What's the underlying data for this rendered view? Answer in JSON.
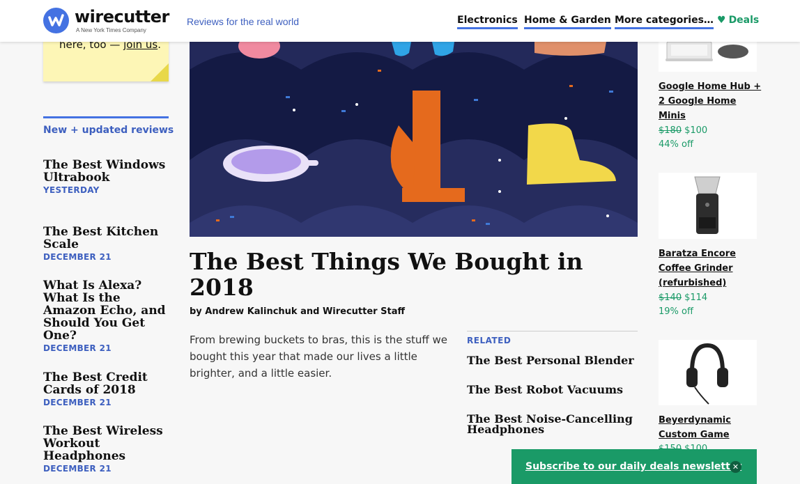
{
  "header": {
    "logo_text": "wirecutter",
    "logo_sub": "A New York Times Company",
    "tagline": "Reviews for the real world",
    "nav": [
      "Electronics",
      "Home & Garden",
      "More categories…"
    ],
    "deals_label": "Deals"
  },
  "sticky": {
    "text_before": "here, too — ",
    "link": "join us",
    "text_after": "."
  },
  "sidebar": {
    "heading": "New + updated reviews",
    "items": [
      {
        "title": "The Best Windows Ultrabook",
        "date": "YESTERDAY"
      },
      {
        "title": "The Best Kitchen Scale",
        "date": "DECEMBER 21"
      },
      {
        "title": "What Is Alexa? What Is the Amazon Echo, and Should You Get One?",
        "date": "DECEMBER 21"
      },
      {
        "title": "The Best Credit Cards of 2018",
        "date": "DECEMBER 21"
      },
      {
        "title": "The Best Wireless Workout Headphones",
        "date": "DECEMBER 21"
      }
    ]
  },
  "article": {
    "title": "The Best Things We Bought in 2018",
    "byline": "by Andrew Kalinchuk and Wirecutter Staff",
    "dek": "From brewing buckets to bras, this is the stuff we bought this year that made our lives a little brighter, and a little easier."
  },
  "related": {
    "heading": "RELATED",
    "items": [
      "The Best Personal Blender",
      "The Best Robot Vacuums",
      "The Best Noise-Cancelling Headphones"
    ]
  },
  "deals": [
    {
      "name": "Google Home Hub + 2 Google Home Minis",
      "old_price": "$180",
      "price": "$100",
      "off": "44% off"
    },
    {
      "name": "Baratza Encore Coffee Grinder (refurbished)",
      "old_price": "$140",
      "price": "$114",
      "off": "19% off"
    },
    {
      "name": "Beyerdynamic Custom Game",
      "old_price": "$150",
      "price": "$100",
      "off": ""
    }
  ],
  "newsletter": {
    "label": "Subscribe to our daily deals newsletter"
  },
  "colors": {
    "brand_blue": "#4472e2",
    "deal_green": "#1a9a67",
    "hero_bg": "#141a44"
  }
}
